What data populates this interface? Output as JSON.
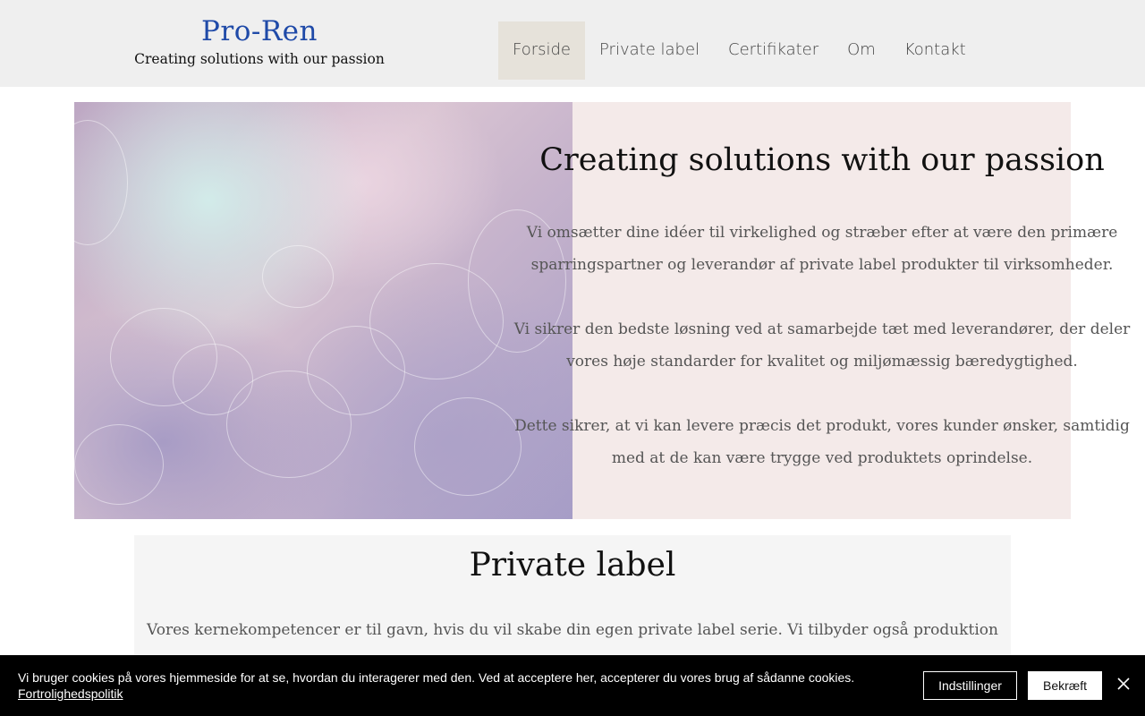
{
  "header": {
    "brand_name": "Pro-Ren",
    "brand_tagline": "Creating solutions with our passion",
    "brand_color": "#1f4aa8",
    "nav": [
      {
        "label": "Forside",
        "active": true
      },
      {
        "label": "Private label",
        "active": false
      },
      {
        "label": "Certifikater",
        "active": false
      },
      {
        "label": "Om",
        "active": false
      },
      {
        "label": "Kontakt",
        "active": false
      }
    ]
  },
  "hero": {
    "title": "Creating solutions with our passion",
    "paragraphs": [
      "Vi omsætter dine idéer til virkelighed og stræber efter at være den primære sparringspartner og leverandør af private label produkter til virksomheder.",
      "Vi sikrer den bedste løsning ved at samarbejde tæt med leverandører, der deler vores høje standarder for kvalitet og miljømæssig bæredygtighed.",
      "Dette sikrer, at vi kan levere præcis det produkt, vores kunder ønsker, samtidig med at de kan være trygge ved produktets oprindelse."
    ]
  },
  "private_label": {
    "title": "Private label",
    "text": "Vores kernekompetencer er til gavn, hvis du vil skabe din egen private label serie. Vi tilbyder også produktion"
  },
  "cookie_banner": {
    "text": "Vi bruger cookies på vores hjemmeside for at se, hvordan du interagerer med den. Ved at acceptere her, accepterer du vores brug af sådanne cookies.",
    "policy_link": "Fortrolighedspolitik",
    "settings_label": "Indstillinger",
    "accept_label": "Bekræft",
    "close_icon": "close-icon"
  }
}
